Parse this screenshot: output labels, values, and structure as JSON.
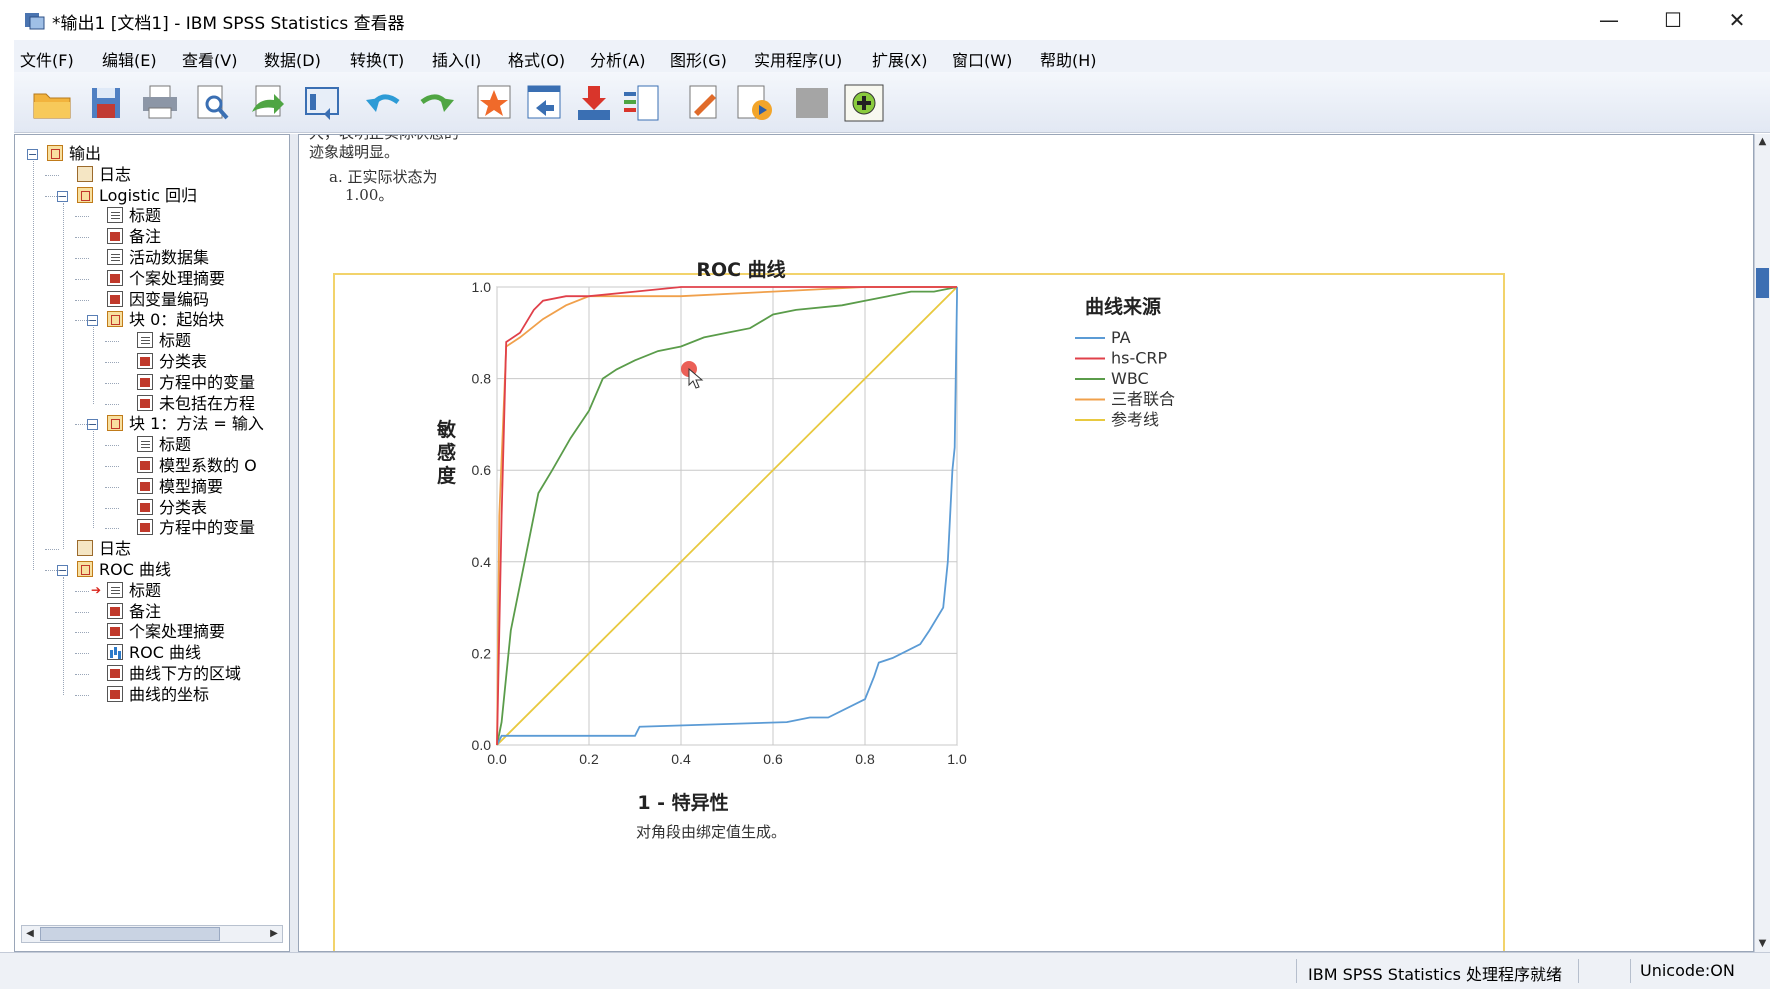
{
  "window": {
    "title": "*输出1 [文档1] - IBM SPSS Statistics 查看器",
    "minimize": "—",
    "maximize": "☐",
    "close": "✕"
  },
  "menu": [
    "文件(F)",
    "编辑(E)",
    "查看(V)",
    "数据(D)",
    "转换(T)",
    "插入(I)",
    "格式(O)",
    "分析(A)",
    "图形(G)",
    "实用程序(U)",
    "扩展(X)",
    "窗口(W)",
    "帮助(H)"
  ],
  "toolbar": {
    "icons": [
      "open-folder-icon",
      "save-icon",
      "print-icon",
      "print-preview-icon",
      "export-icon",
      "recall-dialog-icon",
      "undo-icon",
      "redo-icon",
      "goto-data-icon",
      "goto-case-icon",
      "goto-variable-icon",
      "variables-icon",
      "insert-output-icon",
      "run-script-icon",
      "disabled-icon",
      "add-icon"
    ]
  },
  "tree": [
    {
      "label": "输出",
      "level": 0,
      "icon": "folder",
      "exp": "-"
    },
    {
      "label": "日志",
      "level": 1,
      "icon": "book"
    },
    {
      "label": "Logistic 回归",
      "level": 1,
      "icon": "folder",
      "exp": "-"
    },
    {
      "label": "标题",
      "level": 2,
      "icon": "note"
    },
    {
      "label": "备注",
      "level": 2,
      "icon": "table"
    },
    {
      "label": "活动数据集",
      "level": 2,
      "icon": "note"
    },
    {
      "label": "个案处理摘要",
      "level": 2,
      "icon": "table"
    },
    {
      "label": "因变量编码",
      "level": 2,
      "icon": "table"
    },
    {
      "label": "块 0：起始块",
      "level": 2,
      "icon": "folder",
      "exp": "-"
    },
    {
      "label": "标题",
      "level": 3,
      "icon": "note"
    },
    {
      "label": "分类表",
      "level": 3,
      "icon": "table"
    },
    {
      "label": "方程中的变量",
      "level": 3,
      "icon": "table"
    },
    {
      "label": "未包括在方程",
      "level": 3,
      "icon": "table"
    },
    {
      "label": "块 1：方法 = 输入",
      "level": 2,
      "icon": "folder",
      "exp": "-"
    },
    {
      "label": "标题",
      "level": 3,
      "icon": "note"
    },
    {
      "label": "模型系数的 O",
      "level": 3,
      "icon": "table"
    },
    {
      "label": "模型摘要",
      "level": 3,
      "icon": "table"
    },
    {
      "label": "分类表",
      "level": 3,
      "icon": "table"
    },
    {
      "label": "方程中的变量",
      "level": 3,
      "icon": "table"
    },
    {
      "label": "日志",
      "level": 1,
      "icon": "book"
    },
    {
      "label": "ROC 曲线",
      "level": 1,
      "icon": "folder",
      "exp": "-"
    },
    {
      "label": "标题",
      "level": 2,
      "icon": "note",
      "current": true
    },
    {
      "label": "备注",
      "level": 2,
      "icon": "table"
    },
    {
      "label": "个案处理摘要",
      "level": 2,
      "icon": "table"
    },
    {
      "label": "ROC 曲线",
      "level": 2,
      "icon": "chart"
    },
    {
      "label": "曲线下方的区域",
      "level": 2,
      "icon": "table"
    },
    {
      "label": "曲线的坐标",
      "level": 2,
      "icon": "table"
    }
  ],
  "content": {
    "note_lines": [
      "大，表明正实际状态的",
      "迹象越明显。"
    ],
    "footnote_a": "a. 正实际状态为",
    "footnote_a2": "1.00。",
    "chart_footer": "对角段由绑定值生成。"
  },
  "chart_data": {
    "type": "line",
    "title": "ROC 曲线",
    "xlabel": "1 - 特异性",
    "ylabel": "敏感度",
    "xlim": [
      0,
      1
    ],
    "ylim": [
      0,
      1
    ],
    "xticks": [
      "0.0",
      "0.2",
      "0.4",
      "0.6",
      "0.8",
      "1.0"
    ],
    "yticks": [
      "0.0",
      "0.2",
      "0.4",
      "0.6",
      "0.8",
      "1.0"
    ],
    "grid": true,
    "legend_title": "曲线来源",
    "legend_position": "right",
    "series": [
      {
        "name": "PA",
        "color": "#5b9bd5",
        "x": [
          0,
          0.01,
          0.3,
          0.31,
          0.63,
          0.68,
          0.72,
          0.8,
          0.82,
          0.83,
          0.86,
          0.92,
          0.94,
          0.97,
          0.98,
          0.99,
          0.995,
          1,
          1
        ],
        "y": [
          0,
          0.02,
          0.02,
          0.04,
          0.05,
          0.06,
          0.06,
          0.1,
          0.15,
          0.18,
          0.19,
          0.22,
          0.25,
          0.3,
          0.4,
          0.6,
          0.65,
          0.98,
          1
        ]
      },
      {
        "name": "hs-CRP",
        "color": "#e0404a",
        "x": [
          0,
          0.01,
          0.02,
          0.05,
          0.08,
          0.1,
          0.15,
          0.2,
          0.3,
          0.4,
          0.6,
          0.8,
          1
        ],
        "y": [
          0,
          0.5,
          0.88,
          0.9,
          0.95,
          0.97,
          0.98,
          0.98,
          0.99,
          1,
          1,
          1,
          1
        ]
      },
      {
        "name": "WBC",
        "color": "#5a9c4a",
        "x": [
          0,
          0.01,
          0.03,
          0.05,
          0.07,
          0.09,
          0.12,
          0.16,
          0.2,
          0.23,
          0.26,
          0.3,
          0.35,
          0.4,
          0.45,
          0.5,
          0.55,
          0.6,
          0.65,
          0.75,
          0.8,
          0.85,
          0.9,
          0.95,
          1
        ],
        "y": [
          0,
          0.05,
          0.25,
          0.35,
          0.45,
          0.55,
          0.6,
          0.67,
          0.73,
          0.8,
          0.82,
          0.84,
          0.86,
          0.87,
          0.89,
          0.9,
          0.91,
          0.94,
          0.95,
          0.96,
          0.97,
          0.98,
          0.99,
          0.99,
          1
        ]
      },
      {
        "name": "三者联合",
        "color": "#f0a04b",
        "x": [
          0,
          0.005,
          0.02,
          0.05,
          0.1,
          0.15,
          0.2,
          0.3,
          0.4,
          0.6,
          0.8,
          1
        ],
        "y": [
          0,
          0.5,
          0.87,
          0.89,
          0.93,
          0.96,
          0.98,
          0.98,
          0.98,
          0.99,
          1,
          1
        ]
      },
      {
        "name": "参考线",
        "color": "#e8c93f",
        "x": [
          0,
          1
        ],
        "y": [
          0,
          1
        ]
      }
    ]
  },
  "status": {
    "processor": "IBM SPSS Statistics 处理程序就绪",
    "unicode": "Unicode:ON"
  }
}
